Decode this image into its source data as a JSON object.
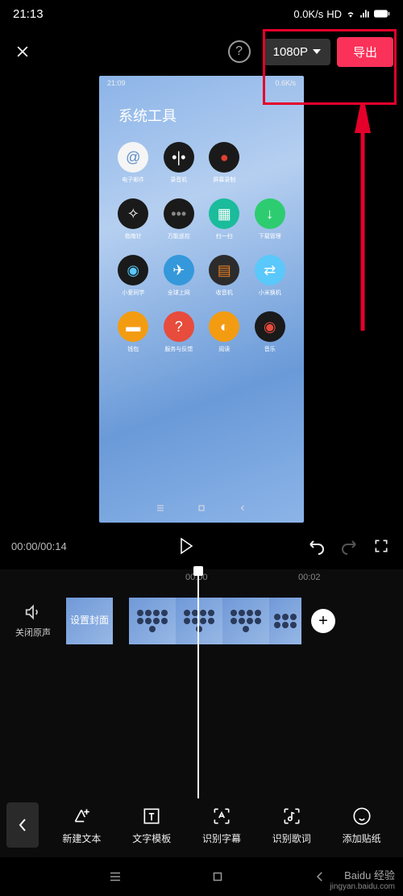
{
  "status": {
    "time": "21:13",
    "netspeed": "0.0K/s",
    "hd": "HD"
  },
  "header": {
    "resolution": "1080P",
    "export": "导出"
  },
  "preview": {
    "status_time": "21:09",
    "status_net": "0.6K/s",
    "title": "系统工具",
    "apps": [
      {
        "label": "电子邮件",
        "bg": "#f5f5f5",
        "color": "#5a8dc8",
        "icon": "@"
      },
      {
        "label": "录音机",
        "bg": "#1a1a1a",
        "color": "#fff",
        "icon": "•|•"
      },
      {
        "label": "屏幕录制",
        "bg": "#1a1a1a",
        "color": "#e04030",
        "icon": "●"
      },
      {
        "label": "",
        "bg": "",
        "color": "",
        "icon": ""
      },
      {
        "label": "指南针",
        "bg": "#1a1a1a",
        "color": "#fff",
        "icon": "✧"
      },
      {
        "label": "万能遥控",
        "bg": "#1a1a1a",
        "color": "#888",
        "icon": "•••"
      },
      {
        "label": "扫一扫",
        "bg": "#1abc9c",
        "color": "#fff",
        "icon": "▦"
      },
      {
        "label": "下载管理",
        "bg": "#2ecc71",
        "color": "#fff",
        "icon": "↓"
      },
      {
        "label": "小爱同学",
        "bg": "#1a1a1a",
        "color": "#5ac8fa",
        "icon": "◉"
      },
      {
        "label": "全球上网",
        "bg": "#3498db",
        "color": "#fff",
        "icon": "✈"
      },
      {
        "label": "收音机",
        "bg": "#2c2c2c",
        "color": "#e67e22",
        "icon": "▤"
      },
      {
        "label": "小米换机",
        "bg": "#5ac8fa",
        "color": "#fff",
        "icon": "⇄"
      },
      {
        "label": "钱包",
        "bg": "#f39c12",
        "color": "#fff",
        "icon": "▬"
      },
      {
        "label": "服务与反馈",
        "bg": "#e74c3c",
        "color": "#fff",
        "icon": "?"
      },
      {
        "label": "阅读",
        "bg": "#f39c12",
        "color": "#fff",
        "icon": "◐"
      },
      {
        "label": "音乐",
        "bg": "#1a1a1a",
        "color": "#e74c3c",
        "icon": "◉"
      }
    ]
  },
  "playback": {
    "current": "00:00",
    "total": "00:14"
  },
  "timeline": {
    "marks": [
      "00:00",
      "00:02"
    ],
    "mute": "关闭原声",
    "cover": "设置封面"
  },
  "tools": [
    {
      "id": "new-text",
      "label": "新建文本"
    },
    {
      "id": "text-template",
      "label": "文字模板"
    },
    {
      "id": "recognize-subtitle",
      "label": "识别字幕"
    },
    {
      "id": "recognize-lyrics",
      "label": "识别歌词"
    },
    {
      "id": "add-sticker",
      "label": "添加贴纸"
    }
  ],
  "watermark": {
    "main": "Baidu 经验",
    "sub": "jingyan.baidu.com"
  }
}
